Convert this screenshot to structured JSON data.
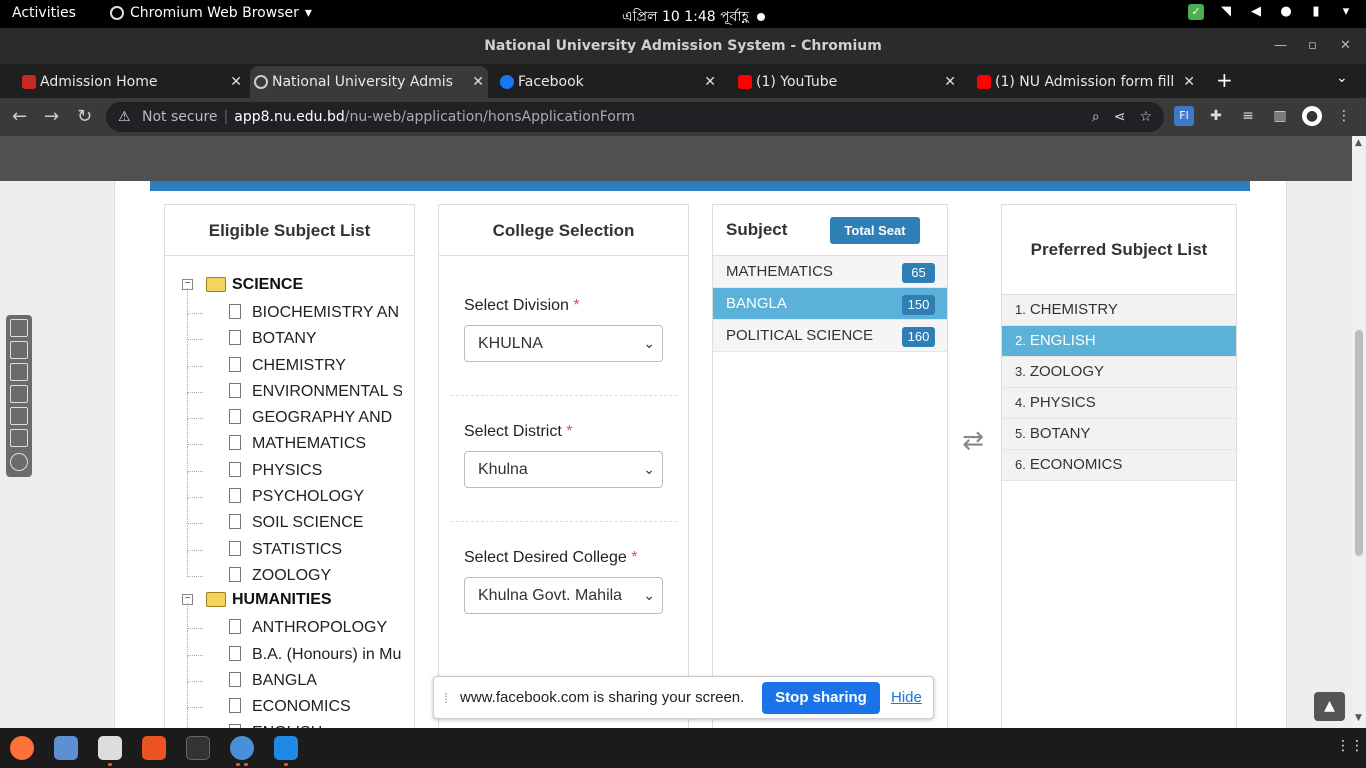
{
  "topbar": {
    "activities": "Activities",
    "app_menu": "Chromium Web Browser",
    "clock": "এপ্রিল 10   1:48 পূর্বাহ্ণ"
  },
  "window": {
    "title": "National University Admission System - Chromium"
  },
  "tabs": [
    {
      "label": "Admission Home",
      "color": "#c62828"
    },
    {
      "label": "National University Admis",
      "color": "#607d8b"
    },
    {
      "label": "Facebook",
      "color": "#1877f2"
    },
    {
      "label": "(1) YouTube",
      "color": "#ff0000"
    },
    {
      "label": "(1) NU Admission form fill",
      "color": "#ff0000"
    }
  ],
  "address_bar": {
    "security": "Not secure",
    "host": "app8.nu.edu.bd",
    "path": "/nu-web/application/honsApplicationForm"
  },
  "eligible": {
    "title": "Eligible Subject List",
    "groups": [
      {
        "label": "SCIENCE",
        "items": [
          "BIOCHEMISTRY AN",
          "BOTANY",
          "CHEMISTRY",
          "ENVIRONMENTAL S",
          "GEOGRAPHY AND",
          "MATHEMATICS",
          "PHYSICS",
          "PSYCHOLOGY",
          "SOIL SCIENCE",
          "STATISTICS",
          "ZOOLOGY"
        ]
      },
      {
        "label": "HUMANITIES",
        "items": [
          "ANTHROPOLOGY",
          "B.A. (Honours) in Mu",
          "BANGLA",
          "ECONOMICS",
          "ENGLISH"
        ]
      }
    ]
  },
  "college": {
    "title": "College Selection",
    "division_label": "Select Division",
    "division_value": "KHULNA",
    "district_label": "Select District",
    "district_value": "Khulna",
    "college_label": "Select Desired College",
    "college_value": "Khulna Govt. Mahila",
    "required_mark": "*"
  },
  "subject": {
    "title": "Subject",
    "total_seat_label": "Total Seat",
    "rows": [
      {
        "name": "MATHEMATICS",
        "seats": "65",
        "selected": false
      },
      {
        "name": "BANGLA",
        "seats": "150",
        "selected": true
      },
      {
        "name": "POLITICAL SCIENCE",
        "seats": "160",
        "selected": false
      }
    ]
  },
  "preferred": {
    "title": "Preferred Subject List",
    "rows": [
      {
        "num": "1.",
        "name": "CHEMISTRY",
        "selected": false
      },
      {
        "num": "2.",
        "name": "ENGLISH",
        "selected": true
      },
      {
        "num": "3.",
        "name": "ZOOLOGY",
        "selected": false
      },
      {
        "num": "4.",
        "name": "PHYSICS",
        "selected": false
      },
      {
        "num": "5.",
        "name": "BOTANY",
        "selected": false
      },
      {
        "num": "6.",
        "name": "ECONOMICS",
        "selected": false
      }
    ]
  },
  "sharebar": {
    "message": "www.facebook.com is sharing your screen.",
    "stop": "Stop sharing",
    "hide": "Hide"
  },
  "colors": {
    "accent": "#2e7fb5",
    "selected_row": "#5bb1d7",
    "header_band": "#505050"
  }
}
